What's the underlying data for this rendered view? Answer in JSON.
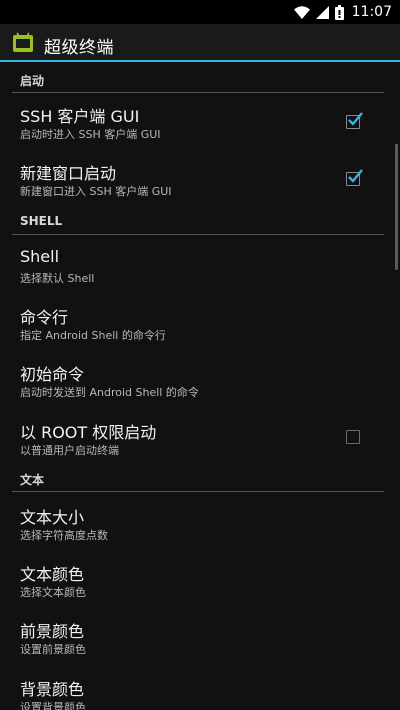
{
  "status_bar": {
    "time": "11:07",
    "icons": [
      "wifi-icon",
      "signal-icon",
      "battery-icon"
    ]
  },
  "action_bar": {
    "title": "超级终端",
    "icon": "android-app-icon"
  },
  "colors": {
    "accent": "#33b5e5",
    "background": "#111111"
  },
  "sections": [
    {
      "header": "启动",
      "items": [
        {
          "title": "SSH 客户端 GUI",
          "summary": "启动时进入 SSH 客户端 GUI",
          "checkbox": true,
          "checked": true
        },
        {
          "title": "新建窗口启动",
          "summary": "新建窗口进入 SSH 客户端 GUI",
          "checkbox": true,
          "checked": true
        }
      ]
    },
    {
      "header": "SHELL",
      "items": [
        {
          "title": "Shell",
          "summary": "选择默认 Shell"
        },
        {
          "title": "命令行",
          "summary": "指定 Android Shell 的命令行"
        },
        {
          "title": "初始命令",
          "summary": "启动时发送到 Android Shell 的命令"
        },
        {
          "title": "以 ROOT 权限启动",
          "summary": "以普通用户启动终端",
          "checkbox": true,
          "checked": false
        }
      ]
    },
    {
      "header": "文本",
      "items": [
        {
          "title": "文本大小",
          "summary": "选择字符高度点数"
        },
        {
          "title": "文本颜色",
          "summary": "选择文本颜色"
        },
        {
          "title": "前景颜色",
          "summary": "设置前景颜色"
        },
        {
          "title": "背景颜色",
          "summary": "设置背景颜色"
        }
      ]
    }
  ]
}
